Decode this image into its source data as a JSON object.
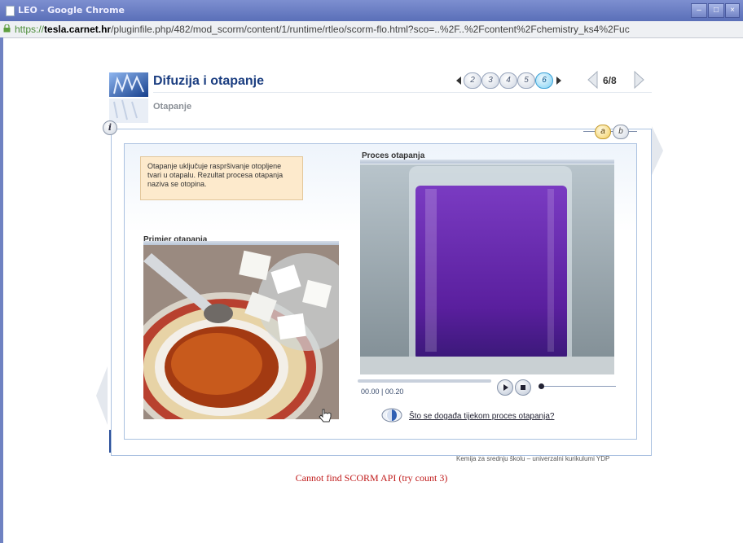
{
  "window": {
    "title": "LEO - Google Chrome",
    "controls": [
      "–",
      "□",
      "×"
    ]
  },
  "address_bar": {
    "protocol": "https://",
    "host": "tesla.carnet.hr",
    "path": "/pluginfile.php/482/mod_scorm/content/1/runtime/rtleo/scorm-flo.html?sco=..%2F..%2Fcontent%2Fchemistry_ks4%2Fuc"
  },
  "lesson": {
    "title": "Difuzija i otapanje",
    "subtitle": "Otapanje",
    "info_label": "i",
    "pager": {
      "pages": [
        "2",
        "3",
        "4",
        "5",
        "6"
      ],
      "active_page": "6",
      "page_count": "6/8"
    },
    "tabs": [
      {
        "label": "a",
        "active": true
      },
      {
        "label": "b",
        "active": false
      }
    ],
    "intro_text": "Otapanje uključuje raspršivanje otopljene tvari u otapalu. Rezultat procesa otapanja naziva se otopina.",
    "example_panel": {
      "title": "Primjer otapanja"
    },
    "video_panel": {
      "title": "Proces otapanja",
      "time": "00.00 | 00.20"
    },
    "question_link": "Što se događa tijekom proces otapanja?",
    "footer": "Kemija za srednju školu – univerzalni kurikulumi YDP"
  },
  "error_message": "Cannot find SCORM API (try count 3)",
  "colors": {
    "title_blue": "#1a3d80",
    "error_red": "#c01a1a",
    "titlebar": "#5a6fb8",
    "solution_purple": "#6a2bb0"
  },
  "icons": [
    "document-icon",
    "lock-icon",
    "leo-logo-icon",
    "info-icon",
    "pager-prev-icon",
    "pager-next-icon",
    "page-back-icon",
    "page-forward-icon",
    "play-icon",
    "stop-icon",
    "question-icon",
    "hand-cursor-icon"
  ]
}
